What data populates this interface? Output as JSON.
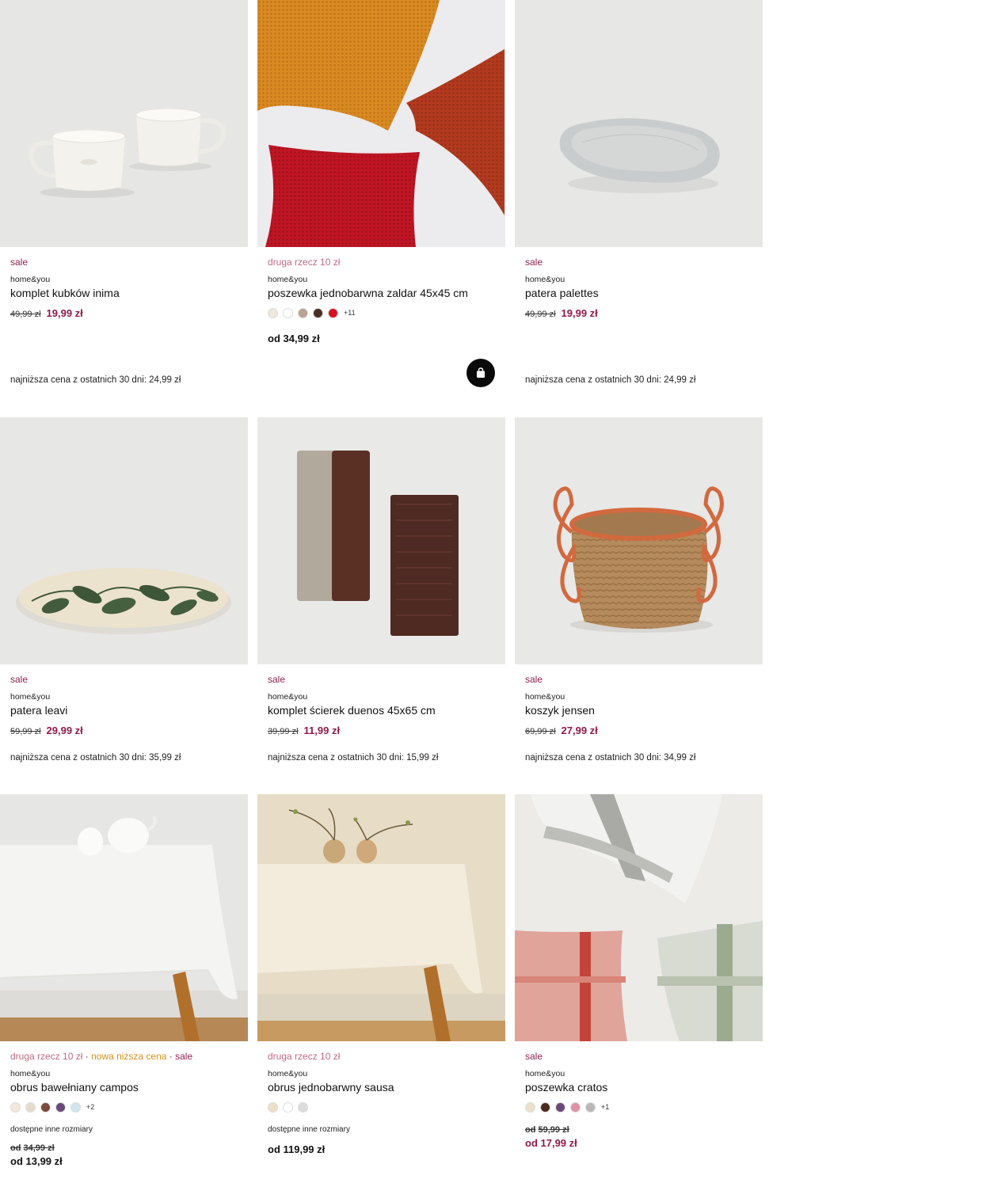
{
  "products": [
    {
      "tags": [
        {
          "text": "sale",
          "style": "sale"
        }
      ],
      "brand": "home&you",
      "name": "komplet kubków inima",
      "old_price": "49,99 zł",
      "new_price": "19,99 zł",
      "lowest_price_note": "najniższa cena z ostatnich 30 dni: 24,99 zł",
      "image": "two white ceramic mugs"
    },
    {
      "tags": [
        {
          "text": "druga rzecz 10 zł",
          "style": "second"
        }
      ],
      "brand": "home&you",
      "name": "poszewka jednobarwna zaldar 45x45 cm",
      "swatches": [
        "#efe6dc",
        "#ffffff",
        "#b9a391",
        "#4a2e24",
        "#d7131e"
      ],
      "more_colors": "+11",
      "from_price": "od 34,99 zł",
      "image": "knitted cushion covers orange red burgundy"
    },
    {
      "tags": [
        {
          "text": "sale",
          "style": "sale"
        }
      ],
      "brand": "home&you",
      "name": "patera palettes",
      "old_price": "49,99 zł",
      "new_price": "19,99 zł",
      "lowest_price_note": "najniższa cena z ostatnich 30 dni: 24,99 zł",
      "image": "light grey ribbed serving bowl"
    },
    {
      "tags": [
        {
          "text": "sale",
          "style": "sale"
        }
      ],
      "brand": "home&you",
      "name": "patera leavi",
      "old_price": "59,99 zł",
      "new_price": "29,99 zł",
      "lowest_price_note": "najniższa cena z ostatnich 30 dni: 35,99 zł",
      "image": "oval platter with green leaf pattern"
    },
    {
      "tags": [
        {
          "text": "sale",
          "style": "sale"
        }
      ],
      "brand": "home&you",
      "name": "komplet ścierek duenos 45x65 cm",
      "old_price": "39,99 zł",
      "new_price": "11,99 zł",
      "lowest_price_note": "najniższa cena z ostatnich 30 dni: 15,99 zł",
      "image": "folded kitchen towels beige and brown"
    },
    {
      "tags": [
        {
          "text": "sale",
          "style": "sale"
        }
      ],
      "brand": "home&you",
      "name": "koszyk jensen",
      "old_price": "69,99 zł",
      "new_price": "27,99 zł",
      "lowest_price_note": "najniższa cena z ostatnich 30 dni: 34,99 zł",
      "image": "woven seagrass basket with terracotta handles"
    },
    {
      "tags": [
        {
          "text": "druga rzecz 10 zł",
          "style": "second"
        },
        {
          "text": " · ",
          "style": "sep"
        },
        {
          "text": "nowa niższa cena",
          "style": "lowest"
        },
        {
          "text": " · ",
          "style": "sep"
        },
        {
          "text": "sale",
          "style": "sale"
        }
      ],
      "brand": "home&you",
      "name": "obrus bawełniany campos",
      "swatches": [
        "#f1e9dc",
        "#e6dccb",
        "#7b4a3c",
        "#6a4a78",
        "#cfe6ee"
      ],
      "more_colors": "+2",
      "sizes_note": "dostępne inne rozmiary",
      "old_from_prefix": "od",
      "old_from_price": "34,99 zł",
      "new_from_price": "od 13,99 zł",
      "image": "white tablecloth on wooden table with teapot"
    },
    {
      "tags": [
        {
          "text": "druga rzecz 10 zł",
          "style": "second"
        }
      ],
      "brand": "home&you",
      "name": "obrus jednobarwny sausa",
      "swatches": [
        "#ece1c8",
        "#ffffff",
        "#dcdcdc"
      ],
      "sizes_note": "dostępne inne rozmiary",
      "from_price": "od 119,99 zł",
      "image": "cream tablecloth with two small vases"
    },
    {
      "tags": [
        {
          "text": "sale",
          "style": "sale"
        }
      ],
      "brand": "home&you",
      "name": "poszewka cratos",
      "swatches": [
        "#ece0c9",
        "#4c2a20",
        "#6a4a78",
        "#e08fa4",
        "#b9b9b9"
      ],
      "more_colors": "+1",
      "old_from_prefix": "od",
      "old_from_price": "59,99 zł",
      "new_from_price": "od 17,99 zł",
      "image": "plaid cushion covers grey pink green"
    }
  ],
  "cart_button": {
    "icon": "shopping-bag-icon"
  }
}
